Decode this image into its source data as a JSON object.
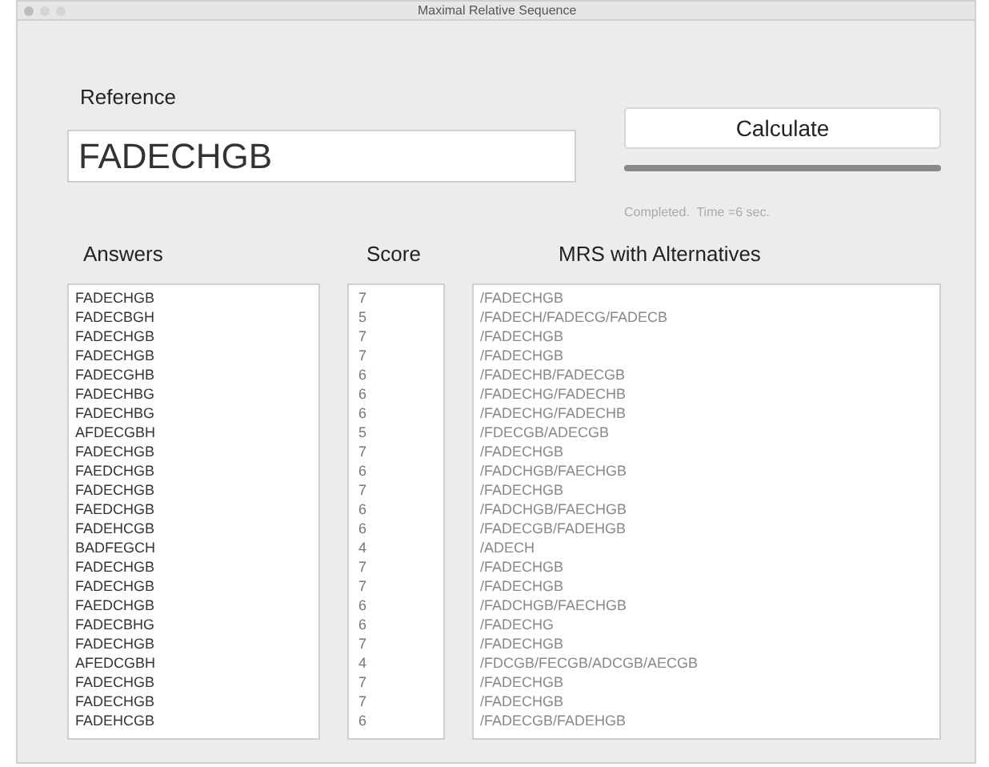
{
  "window": {
    "title": "Maximal Relative Sequence"
  },
  "reference": {
    "label": "Reference",
    "value": "FADECHGB"
  },
  "calculate_button": "Calculate",
  "progress": {
    "level": 1
  },
  "status": "Completed.  Time =6 sec.",
  "columns": [
    "Answers",
    "Score",
    "MRS with Alternatives"
  ],
  "rows": [
    {
      "answer": "FADECHGB",
      "score": "7",
      "mrs": "/FADECHGB"
    },
    {
      "answer": "FADECBGH",
      "score": "5",
      "mrs": "/FADECH/FADECG/FADECB"
    },
    {
      "answer": "FADECHGB",
      "score": "7",
      "mrs": "/FADECHGB"
    },
    {
      "answer": "FADECHGB",
      "score": "7",
      "mrs": "/FADECHGB"
    },
    {
      "answer": "FADECGHB",
      "score": "6",
      "mrs": "/FADECHB/FADECGB"
    },
    {
      "answer": "FADECHBG",
      "score": "6",
      "mrs": "/FADECHG/FADECHB"
    },
    {
      "answer": "FADECHBG",
      "score": "6",
      "mrs": "/FADECHG/FADECHB"
    },
    {
      "answer": "AFDECGBH",
      "score": "5",
      "mrs": "/FDECGB/ADECGB"
    },
    {
      "answer": "FADECHGB",
      "score": "7",
      "mrs": "/FADECHGB"
    },
    {
      "answer": "FAEDCHGB",
      "score": "6",
      "mrs": "/FADCHGB/FAECHGB"
    },
    {
      "answer": "FADECHGB",
      "score": "7",
      "mrs": "/FADECHGB"
    },
    {
      "answer": "FAEDCHGB",
      "score": "6",
      "mrs": "/FADCHGB/FAECHGB"
    },
    {
      "answer": "FADEHCGB",
      "score": "6",
      "mrs": "/FADECGB/FADEHGB"
    },
    {
      "answer": "BADFEGCH",
      "score": "4",
      "mrs": "/ADECH"
    },
    {
      "answer": "FADECHGB",
      "score": "7",
      "mrs": "/FADECHGB"
    },
    {
      "answer": "FADECHGB",
      "score": "7",
      "mrs": "/FADECHGB"
    },
    {
      "answer": "FAEDCHGB",
      "score": "6",
      "mrs": "/FADCHGB/FAECHGB"
    },
    {
      "answer": "FADECBHG",
      "score": "6",
      "mrs": "/FADECHG"
    },
    {
      "answer": "FADECHGB",
      "score": "7",
      "mrs": "/FADECHGB"
    },
    {
      "answer": "AFEDCGBH",
      "score": "4",
      "mrs": "/FDCGB/FECGB/ADCGB/AECGB"
    },
    {
      "answer": "FADECHGB",
      "score": "7",
      "mrs": "/FADECHGB"
    },
    {
      "answer": "FADECHGB",
      "score": "7",
      "mrs": "/FADECHGB"
    },
    {
      "answer": "FADEHCGB",
      "score": "6",
      "mrs": "/FADECGB/FADEHGB"
    }
  ]
}
